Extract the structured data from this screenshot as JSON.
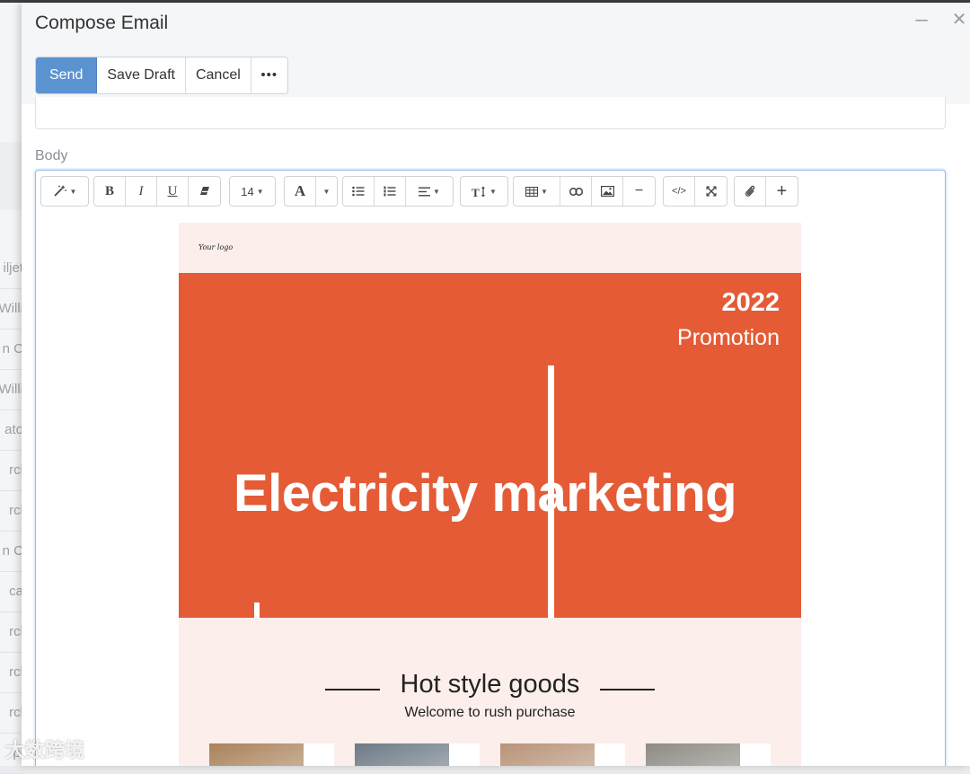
{
  "background": {
    "row_fragments": [
      "iljet",
      "Willi",
      "n C",
      "Willi",
      "ato",
      "rcl",
      "rcl",
      "n C",
      "ca",
      "rcl",
      "rcl",
      "rcl",
      "pi"
    ]
  },
  "dialog": {
    "title": "Compose Email",
    "minimize_glyph": "–",
    "close_glyph": "✕",
    "actions": {
      "send": "Send",
      "save_draft": "Save Draft",
      "cancel": "Cancel",
      "more": "•••"
    },
    "body_label": "Body"
  },
  "toolbar": {
    "font_size": "14",
    "bold": "B",
    "italic": "I",
    "underline": "U",
    "font_color": "A",
    "code": "</>",
    "hr": "−",
    "add": "+"
  },
  "email": {
    "logo_text": "Your logo",
    "banner_year": "2022",
    "banner_subtitle": "Promotion",
    "banner_title": "Electricity marketing",
    "section_title": "Hot style goods",
    "section_subtitle": "Welcome to rush purchase",
    "products": [
      {
        "image": "bread-photo",
        "color": "#a9825a"
      },
      {
        "image": "shoes-photo",
        "color": "#6d7a86"
      },
      {
        "image": "wood-photo",
        "color": "#b89378"
      },
      {
        "image": "bottles-photo",
        "color": "#8f8a84"
      }
    ]
  },
  "watermark": "大数跨境",
  "colors": {
    "primary_button": "#5b93d1",
    "banner": "#e45b36",
    "email_bg": "#fbeeeb"
  }
}
